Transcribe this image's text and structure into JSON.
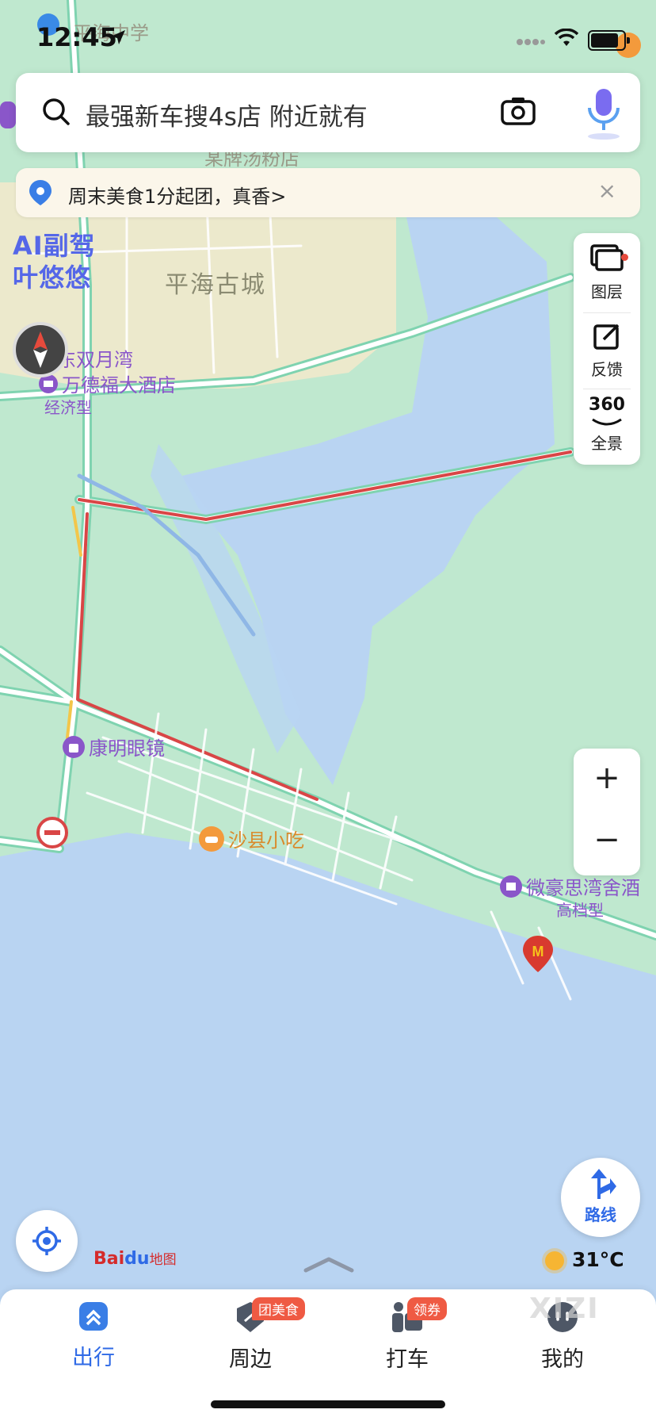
{
  "status": {
    "time": "12:45"
  },
  "search": {
    "placeholder": "最强新车搜4s店 附近就有"
  },
  "banner": {
    "text": "周末美食1分起团，真香>",
    "close": "×"
  },
  "ai_copilot": {
    "line1": "AI副驾",
    "line2": "叶悠悠"
  },
  "right_panel": {
    "items": [
      {
        "label": "图层",
        "icon": "layers-icon"
      },
      {
        "label": "反馈",
        "icon": "feedback-icon"
      },
      {
        "label": "全景",
        "icon": "panorama-360-icon",
        "badge": "360"
      }
    ]
  },
  "zoom": {
    "plus": "+",
    "minus": "−"
  },
  "route": {
    "label": "路线"
  },
  "map": {
    "area_label": "平海古城",
    "top_labels": [
      "平海中学",
      "某牌汤粉店"
    ],
    "pois": [
      {
        "name": "康东双月湾",
        "color": "#8a56c9"
      },
      {
        "name": "万德福大酒店",
        "color": "#8a56c9"
      },
      {
        "name": "经济型",
        "color": "#8a56c9"
      },
      {
        "name": "康明眼镜",
        "color": "#8a56c9"
      },
      {
        "name": "沙县小吃",
        "color": "#d98a2b"
      },
      {
        "name": "微豪思湾舍酒",
        "color": "#8a56c9"
      },
      {
        "name": "高档型",
        "color": "#8a56c9"
      }
    ]
  },
  "brand": {
    "bai": "Bai",
    "du": "du",
    "map": "地图"
  },
  "weather": {
    "temp": "31°C"
  },
  "tabs": [
    {
      "label": "出行",
      "active": true,
      "icon": "travel-icon"
    },
    {
      "label": "周边",
      "active": false,
      "icon": "nearby-icon",
      "tag": "团美食"
    },
    {
      "label": "打车",
      "active": false,
      "icon": "taxi-icon",
      "tag": "领券"
    },
    {
      "label": "我的",
      "active": false,
      "icon": "profile-icon"
    }
  ],
  "watermark": "XIZI",
  "colors": {
    "land": "#bfe8cf",
    "town": "#ece9cc",
    "water": "#b9d4f2",
    "road": "#ffffff",
    "road_edge": "#7fd3b0",
    "traffic_red": "#d94646",
    "accent": "#2f6ae6"
  }
}
